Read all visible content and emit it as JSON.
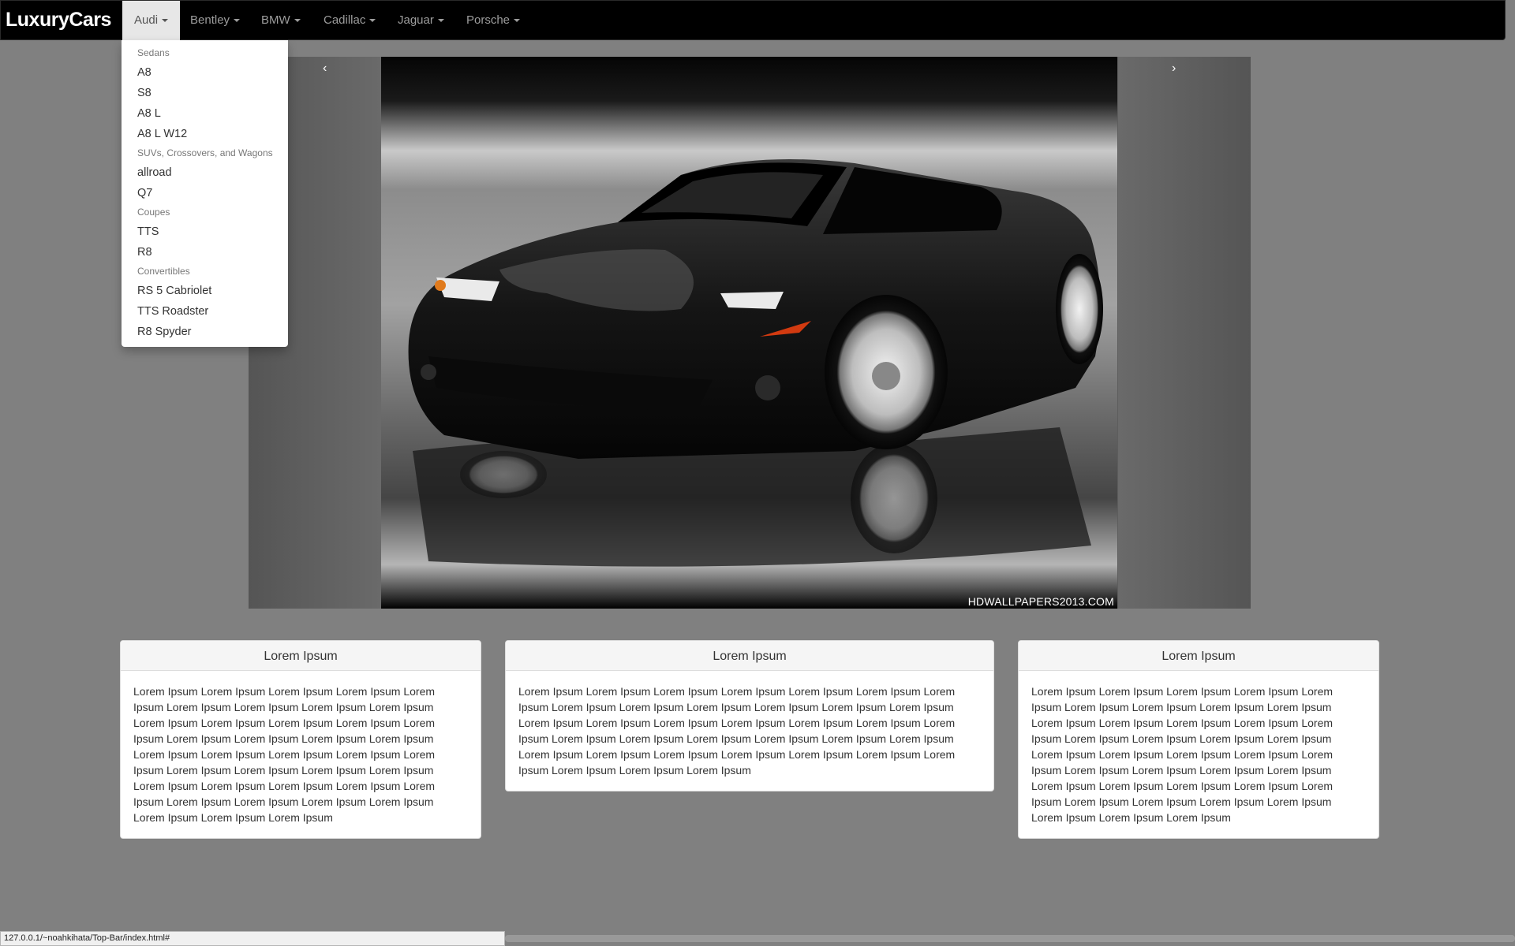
{
  "navbar": {
    "brand": "LuxuryCars",
    "items": [
      {
        "label": "Audi"
      },
      {
        "label": "Bentley"
      },
      {
        "label": "BMW"
      },
      {
        "label": "Cadillac"
      },
      {
        "label": "Jaguar"
      },
      {
        "label": "Porsche"
      }
    ],
    "active_item": "Audi"
  },
  "dropdown": {
    "groups": [
      {
        "header": "Sedans",
        "items": [
          "A8",
          "S8",
          "A8 L",
          "A8 L W12"
        ]
      },
      {
        "header": "SUVs, Crossovers, and Wagons",
        "items": [
          "allroad",
          "Q7"
        ]
      },
      {
        "header": "Coupes",
        "items": [
          "TTS",
          "R8"
        ]
      },
      {
        "header": "Convertibles",
        "items": [
          "RS 5 Cabriolet",
          "TTS Roadster",
          "R8 Spyder"
        ]
      }
    ]
  },
  "carousel": {
    "prev_symbol": "‹",
    "next_symbol": "›",
    "watermark": "HDWALLPAPERS2013.COM"
  },
  "panels": [
    {
      "title": "Lorem Ipsum",
      "body": "Lorem Ipsum Lorem Ipsum Lorem Ipsum Lorem Ipsum Lorem Ipsum Lorem Ipsum Lorem Ipsum Lorem Ipsum Lorem Ipsum Lorem Ipsum Lorem Ipsum Lorem Ipsum Lorem Ipsum Lorem Ipsum Lorem Ipsum Lorem Ipsum Lorem Ipsum Lorem Ipsum Lorem Ipsum Lorem Ipsum Lorem Ipsum Lorem Ipsum Lorem Ipsum Lorem Ipsum Lorem Ipsum Lorem Ipsum Lorem Ipsum Lorem Ipsum Lorem Ipsum Lorem Ipsum Lorem Ipsum Lorem Ipsum Lorem Ipsum Lorem Ipsum Lorem Ipsum Lorem Ipsum Lorem Ipsum Lorem Ipsum Lorem Ipsum"
    },
    {
      "title": "Lorem Ipsum",
      "body": "Lorem Ipsum Lorem Ipsum Lorem Ipsum Lorem Ipsum Lorem Ipsum Lorem Ipsum Lorem Ipsum Lorem Ipsum Lorem Ipsum Lorem Ipsum Lorem Ipsum Lorem Ipsum Lorem Ipsum Lorem Ipsum Lorem Ipsum Lorem Ipsum Lorem Ipsum Lorem Ipsum Lorem Ipsum Lorem Ipsum Lorem Ipsum Lorem Ipsum Lorem Ipsum Lorem Ipsum Lorem Ipsum Lorem Ipsum Lorem Ipsum Lorem Ipsum Lorem Ipsum Lorem Ipsum Lorem Ipsum Lorem Ipsum Lorem Ipsum Lorem Ipsum Lorem Ipsum Lorem Ipsum"
    },
    {
      "title": "Lorem Ipsum",
      "body": "Lorem Ipsum Lorem Ipsum Lorem Ipsum Lorem Ipsum Lorem Ipsum Lorem Ipsum Lorem Ipsum Lorem Ipsum Lorem Ipsum Lorem Ipsum Lorem Ipsum Lorem Ipsum Lorem Ipsum Lorem Ipsum Lorem Ipsum Lorem Ipsum Lorem Ipsum Lorem Ipsum Lorem Ipsum Lorem Ipsum Lorem Ipsum Lorem Ipsum Lorem Ipsum Lorem Ipsum Lorem Ipsum Lorem Ipsum Lorem Ipsum Lorem Ipsum Lorem Ipsum Lorem Ipsum Lorem Ipsum Lorem Ipsum Lorem Ipsum Lorem Ipsum Lorem Ipsum Lorem Ipsum Lorem Ipsum Lorem Ipsum Lorem Ipsum"
    }
  ],
  "status_bar": {
    "url": "127.0.0.1/~noahkihata/Top-Bar/index.html#"
  },
  "colors": {
    "page_background": "#808080",
    "navbar_background": "#000000",
    "active_tab_background": "#e7e7e7"
  }
}
